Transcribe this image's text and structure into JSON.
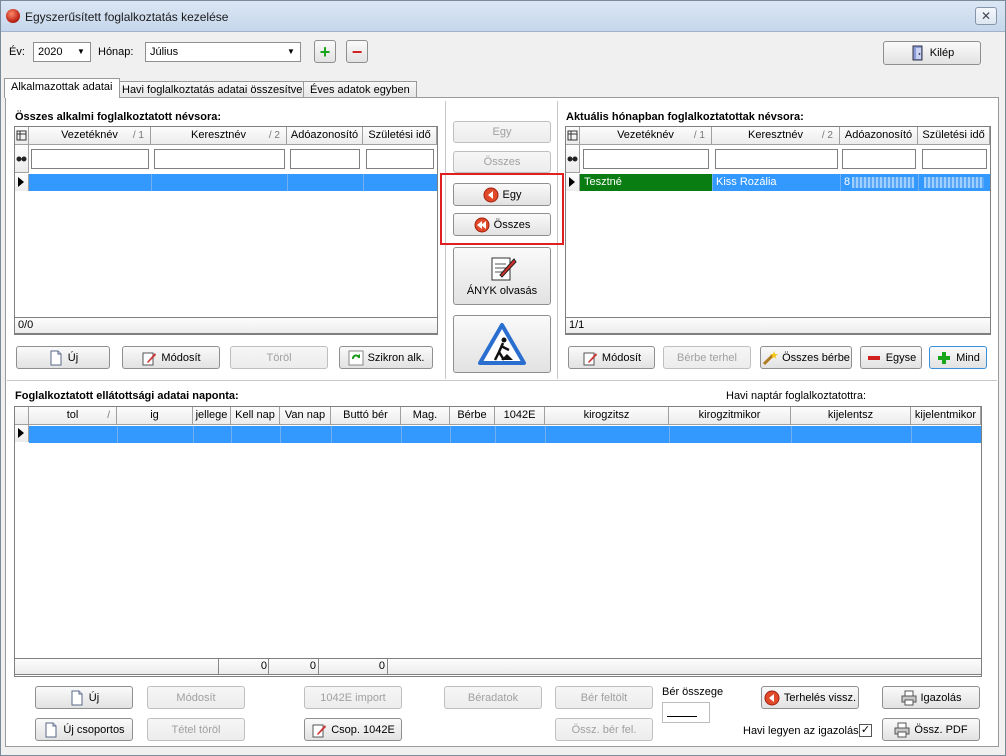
{
  "window": {
    "title": "Egyszerűsített foglalkoztatás kezelése",
    "close_glyph": "✕"
  },
  "toolbar": {
    "year_label": "Év:",
    "year_value": "2020",
    "month_label": "Hónap:",
    "month_value": "Július",
    "add_glyph": "+",
    "remove_glyph": "−",
    "exit_label": "Kilép"
  },
  "tabs": [
    {
      "label": "Alkalmazottak adatai",
      "active": true
    },
    {
      "label": "Havi foglalkoztatás adatai összesítve",
      "active": false
    },
    {
      "label": "Éves adatok egyben",
      "active": false
    }
  ],
  "left_panel": {
    "title": "Összes alkalmi foglalkoztatott névsora:",
    "columns": [
      {
        "label": "Vezetéknév",
        "sort": "/ 1"
      },
      {
        "label": "Keresztnév",
        "sort": "/ 2"
      },
      {
        "label": "Adóazonosító",
        "sort": ""
      },
      {
        "label": "Születési idő",
        "sort": ""
      }
    ],
    "footer": "0/0",
    "buttons": {
      "new": "Új",
      "modify": "Módosít",
      "delete": "Töröl",
      "sync": "Szikron alk."
    }
  },
  "middle": {
    "btn_one_right": "Egy",
    "btn_all_right": "Összes",
    "btn_one_left": "Egy",
    "btn_all_left": "Összes",
    "anyk_label": "ÁNYK olvasás"
  },
  "right_panel": {
    "title": "Aktuális hónapban foglalkoztatottak névsora:",
    "columns": [
      {
        "label": "Vezetéknév",
        "sort": "/ 1"
      },
      {
        "label": "Keresztnév",
        "sort": "/ 2"
      },
      {
        "label": "Adóazonosító",
        "sort": ""
      },
      {
        "label": "Születési idő",
        "sort": ""
      }
    ],
    "row": {
      "last_name": "Tesztné",
      "first_name": "Kiss Rozália",
      "tax_id": "8",
      "birth": ""
    },
    "footer": "1/1",
    "buttons": {
      "modify": "Módosít",
      "lend": "Bérbe terhel",
      "all_lend": "Összes bérbe",
      "single": "Egyse",
      "all": "Mind"
    }
  },
  "daily": {
    "title": "Foglalkoztatott ellátottsági adatai naponta:",
    "calendar_label": "Havi naptár foglalkoztatottra:",
    "columns": [
      {
        "label": "tol",
        "sort": "/"
      },
      {
        "label": "ig",
        "sort": ""
      },
      {
        "label": "jellege",
        "sort": ""
      },
      {
        "label": "Kell nap",
        "sort": ""
      },
      {
        "label": "Van nap",
        "sort": ""
      },
      {
        "label": "Buttó bér",
        "sort": ""
      },
      {
        "label": "Mag.",
        "sort": ""
      },
      {
        "label": "Bérbe",
        "sort": ""
      },
      {
        "label": "1042E",
        "sort": ""
      },
      {
        "label": "kirogzitsz",
        "sort": ""
      },
      {
        "label": "kirogzitmikor",
        "sort": ""
      },
      {
        "label": "kijelentsz",
        "sort": ""
      },
      {
        "label": "kijelentmikor",
        "sort": ""
      }
    ],
    "totals": [
      "0",
      "0",
      "0"
    ]
  },
  "bottom": {
    "new": "Új",
    "new_group": "Új csoportos",
    "modify": "Módosít",
    "item_delete": "Tétel töröl",
    "import_1042e": "1042E import",
    "group_1042e": "Csop. 1042E",
    "wage_data": "Béradatok",
    "wage_upload": "Bér feltölt",
    "sum_wage": "Össz. bér fel.",
    "wage_total_label": "Bér összege",
    "load_back": "Terhelés vissz.",
    "certificate": "Igazolás",
    "sum_pdf": "Össz. PDF",
    "monthly_cert_label": "Havi legyen az igazolás",
    "monthly_cert_checked": true
  }
}
